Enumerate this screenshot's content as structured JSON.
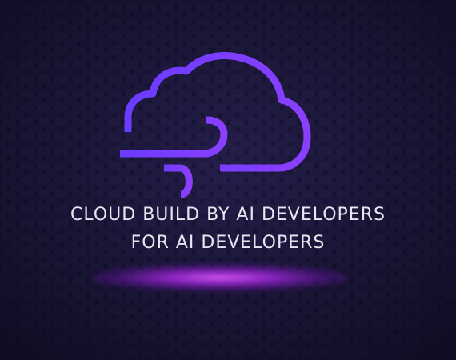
{
  "brand": {
    "accent_color": "#7d3cff",
    "glow_color": "#c04bff",
    "background_color": "#15112d",
    "icon": "cloud-wind-icon"
  },
  "headline": {
    "line1": "CLOUD BUILD BY AI DEVELOPERS",
    "line2": "FOR AI DEVELOPERS"
  }
}
